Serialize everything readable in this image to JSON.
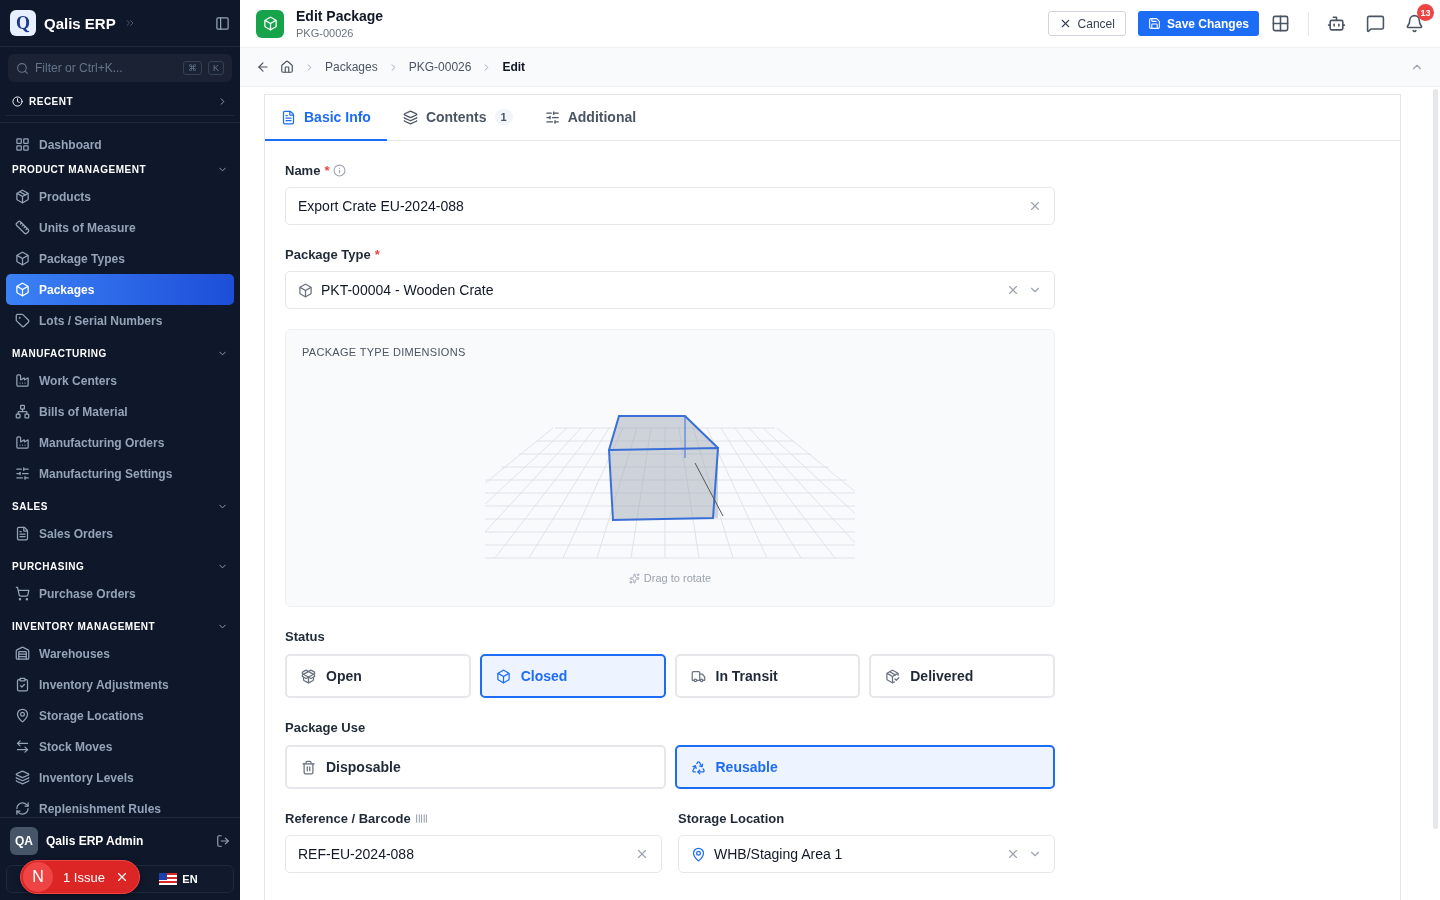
{
  "sidebar": {
    "brand": {
      "logo_letter": "Q",
      "name": "Qalis ERP"
    },
    "search": {
      "placeholder": "Filter or Ctrl+K...",
      "keys": [
        "⌘",
        "K"
      ]
    },
    "recent": {
      "label": "RECENT",
      "expanded": false
    },
    "top_items": [
      {
        "label": "Dashboard",
        "selected": false
      }
    ],
    "sections": [
      {
        "title": "PRODUCT MANAGEMENT",
        "expanded": true,
        "items": [
          {
            "label": "Products",
            "selected": false
          },
          {
            "label": "Units of Measure",
            "selected": false
          },
          {
            "label": "Package Types",
            "selected": false
          },
          {
            "label": "Packages",
            "selected": true
          },
          {
            "label": "Lots / Serial Numbers",
            "selected": false
          }
        ]
      },
      {
        "title": "MANUFACTURING",
        "expanded": true,
        "items": [
          {
            "label": "Work Centers",
            "selected": false
          },
          {
            "label": "Bills of Material",
            "selected": false
          },
          {
            "label": "Manufacturing Orders",
            "selected": false
          },
          {
            "label": "Manufacturing Settings",
            "selected": false
          }
        ]
      },
      {
        "title": "SALES",
        "expanded": true,
        "items": [
          {
            "label": "Sales Orders",
            "selected": false
          }
        ]
      },
      {
        "title": "PURCHASING",
        "expanded": true,
        "items": [
          {
            "label": "Purchase Orders",
            "selected": false
          }
        ]
      },
      {
        "title": "INVENTORY MANAGEMENT",
        "expanded": true,
        "items": [
          {
            "label": "Warehouses",
            "selected": false
          },
          {
            "label": "Inventory Adjustments",
            "selected": false
          },
          {
            "label": "Storage Locations",
            "selected": false
          },
          {
            "label": "Stock Moves",
            "selected": false
          },
          {
            "label": "Inventory Levels",
            "selected": false
          },
          {
            "label": "Replenishment Rules",
            "selected": false
          }
        ]
      }
    ],
    "user": {
      "initials": "QA",
      "name": "Qalis ERP Admin"
    },
    "language": "EN"
  },
  "toast": {
    "letter": "N",
    "text": "1 Issue"
  },
  "header": {
    "title": "Edit Package",
    "subtitle": "PKG-00026",
    "cancel": "Cancel",
    "save": "Save Changes",
    "notifications": "13"
  },
  "breadcrumb": [
    "Packages",
    "PKG-00026",
    "Edit"
  ],
  "tabs": [
    {
      "label": "Basic Info",
      "selected": true
    },
    {
      "label": "Contents",
      "count": "1",
      "selected": false
    },
    {
      "label": "Additional",
      "selected": false
    }
  ],
  "form": {
    "name": {
      "label": "Name",
      "required_mark": "*",
      "value": "Export Crate EU-2024-088"
    },
    "package_type": {
      "label": "Package Type",
      "required_mark": "*",
      "value": "PKT-00004 - Wooden Crate"
    },
    "dimensions": {
      "title": "PACKAGE TYPE DIMENSIONS",
      "hint": "Drag to rotate"
    },
    "status": {
      "label": "Status",
      "options": [
        {
          "label": "Open",
          "selected": false
        },
        {
          "label": "Closed",
          "selected": true
        },
        {
          "label": "In Transit",
          "selected": false
        },
        {
          "label": "Delivered",
          "selected": false
        }
      ]
    },
    "package_use": {
      "label": "Package Use",
      "options": [
        {
          "label": "Disposable",
          "selected": false
        },
        {
          "label": "Reusable",
          "selected": true
        }
      ]
    },
    "reference": {
      "label": "Reference / Barcode",
      "value": "REF-EU-2024-088"
    },
    "storage_location": {
      "label": "Storage Location",
      "value": "WHB/Staging Area 1"
    }
  }
}
